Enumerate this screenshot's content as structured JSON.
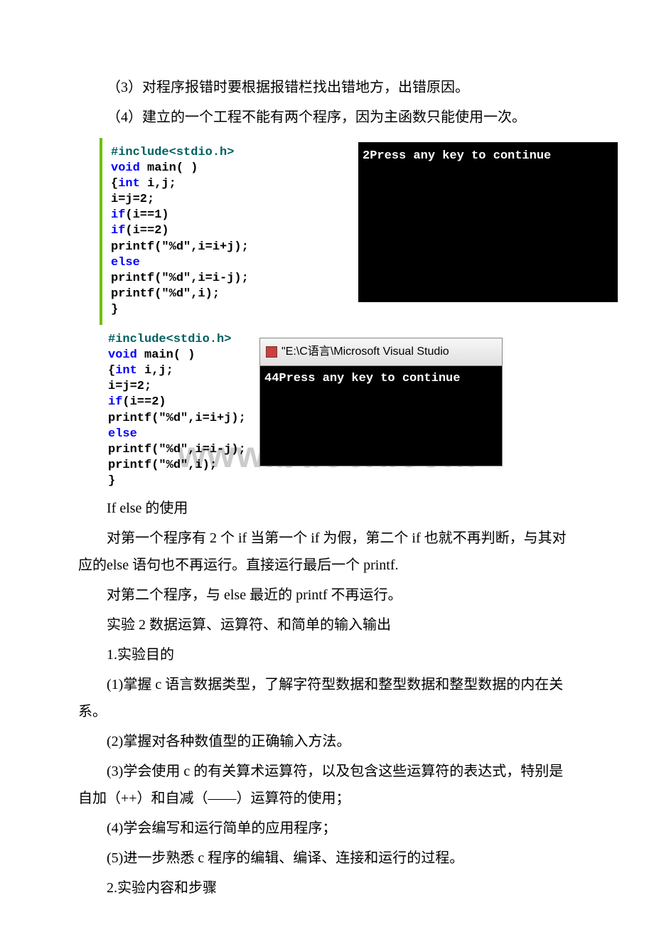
{
  "paragraphs": {
    "p1": "（3）对程序报错时要根据报错栏找出错地方，出错原因。",
    "p2": "（4）建立的一个工程不能有两个程序，因为主函数只能使用一次。",
    "after_img": "If else 的使用",
    "p3": "对第一个程序有 2 个 if 当第一个 if 为假，第二个 if 也就不再判断，与其对应的else 语句也不再运行。直接运行最后一个 printf.",
    "p4": "对第二个程序，与 else 最近的 printf 不再运行。",
    "p5": " 实验 2 数据运算、运算符、和简单的输入输出",
    "p6": "1.实验目的",
    "p7": "(1)掌握 c 语言数据类型，了解字符型数据和整型数据和整型数据的内在关系。",
    "p8": "(2)掌握对各种数值型的正确输入方法。",
    "p9": "(3)学会使用 c 的有关算术运算符，以及包含这些运算符的表达式，特别是自加（++）和自减（——）运算符的使用；",
    "p10": "(4)学会编写和运行简单的应用程序；",
    "p11": "(5)进一步熟悉 c 程序的编辑、编译、连接和运行的过程。",
    "p12": "2.实验内容和步骤"
  },
  "code1": {
    "l1a": "#include",
    "l1b": "<stdio.h>",
    "l2a": "void",
    "l2b": " main( )",
    "l3a": "{",
    "l3b": "int",
    "l3c": " i,j;",
    "l4": "i=j=2;",
    "l5a": "if",
    "l5b": "(i==1)",
    "l6a": "if",
    "l6b": "(i==2)",
    "l7": "printf(\"%d\",i=i+j);",
    "l8": "else",
    "l9": "printf(\"%d\",i=i-j);",
    "l10": "printf(\"%d\",i);",
    "l11": "}"
  },
  "console1_text": "2Press any key to continue",
  "code2": {
    "l1a": "#include",
    "l1b": "<stdio.h>",
    "l2a": "void",
    "l2b": " main( )",
    "l3a": "{",
    "l3b": "int",
    "l3c": " i,j;",
    "l4": "i=j=2;",
    "l5a": "if",
    "l5b": "(i==2)",
    "l6": "printf(\"%d\",i=i+j);",
    "l7": "else",
    "l8": "printf(\"%d\",i=i-j);",
    "l9": "printf(\"%d\",i);",
    "l10": "}"
  },
  "console2_title": "\"E:\\C语言\\Microsoft Visual Studio",
  "console2_text": "44Press any key to continue",
  "watermark": "www.bdocx.com"
}
